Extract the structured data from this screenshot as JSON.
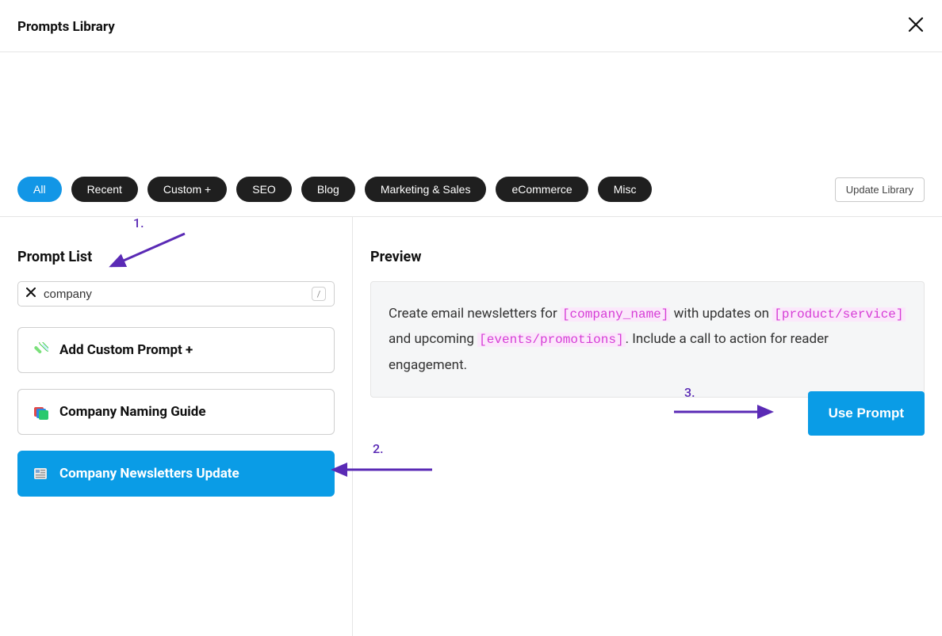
{
  "header": {
    "title": "Prompts Library"
  },
  "filters": {
    "pills": [
      "All",
      "Recent",
      "Custom +",
      "SEO",
      "Blog",
      "Marketing & Sales",
      "eCommerce",
      "Misc"
    ],
    "active_index": 0,
    "update_button": "Update Library"
  },
  "prompt_list": {
    "title": "Prompt List",
    "search_value": "company",
    "slash_hint": "/",
    "add_custom_label": "Add Custom Prompt +",
    "items": [
      {
        "label": "Company Naming Guide",
        "selected": false
      },
      {
        "label": "Company Newsletters Update",
        "selected": true
      }
    ]
  },
  "preview": {
    "title": "Preview",
    "text_parts": {
      "t1": "Create email newsletters for ",
      "ph1": "[company_name]",
      "t2": " with updates on ",
      "ph2": "[product/service]",
      "t3": " and upcoming ",
      "ph3": "[events/promotions]",
      "t4": ". Include a call to action for reader engagement."
    },
    "use_button": "Use Prompt"
  },
  "annotations": {
    "a1": "1.",
    "a2": "2.",
    "a3": "3."
  }
}
